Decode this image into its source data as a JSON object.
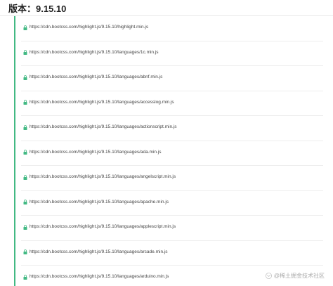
{
  "header": {
    "version_label": "版本：9.15.10"
  },
  "colors": {
    "accent": "#42b983",
    "text": "#444444",
    "lock": "#42b983"
  },
  "files": [
    {
      "url": "https://cdn.bootcss.com/highlight.js/9.15.10/highlight.min.js",
      "icon": "lock-icon"
    },
    {
      "url": "https://cdn.bootcss.com/highlight.js/9.15.10/languages/1c.min.js",
      "icon": "lock-icon"
    },
    {
      "url": "https://cdn.bootcss.com/highlight.js/9.15.10/languages/abnf.min.js",
      "icon": "lock-icon"
    },
    {
      "url": "https://cdn.bootcss.com/highlight.js/9.15.10/languages/accesslog.min.js",
      "icon": "lock-icon"
    },
    {
      "url": "https://cdn.bootcss.com/highlight.js/9.15.10/languages/actionscript.min.js",
      "icon": "lock-icon"
    },
    {
      "url": "https://cdn.bootcss.com/highlight.js/9.15.10/languages/ada.min.js",
      "icon": "lock-icon"
    },
    {
      "url": "https://cdn.bootcss.com/highlight.js/9.15.10/languages/angelscript.min.js",
      "icon": "lock-icon"
    },
    {
      "url": "https://cdn.bootcss.com/highlight.js/9.15.10/languages/apache.min.js",
      "icon": "lock-icon"
    },
    {
      "url": "https://cdn.bootcss.com/highlight.js/9.15.10/languages/applescript.min.js",
      "icon": "lock-icon"
    },
    {
      "url": "https://cdn.bootcss.com/highlight.js/9.15.10/languages/arcade.min.js",
      "icon": "lock-icon"
    },
    {
      "url": "https://cdn.bootcss.com/highlight.js/9.15.10/languages/arduino.min.js",
      "icon": "lock-icon"
    }
  ],
  "watermark": {
    "text": "@稀土掘金技术社区",
    "icon": "juejin-logo-icon"
  }
}
